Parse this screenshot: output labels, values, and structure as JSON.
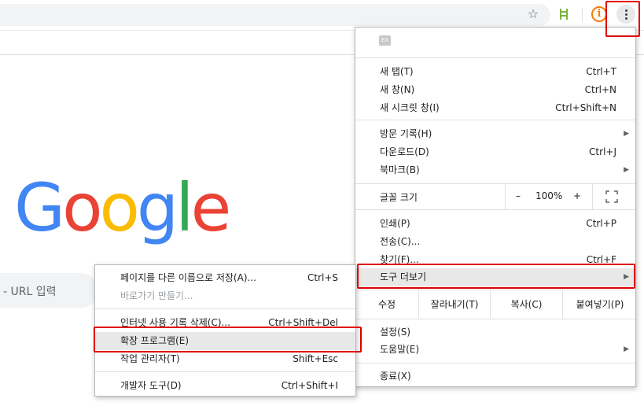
{
  "toolbar": {
    "star_icon": "star-icon",
    "extension_icons": [
      "ladder-extension-icon",
      "info-extension-icon"
    ],
    "info_glyph": "i"
  },
  "page": {
    "logo_text": "Google",
    "logo_letters": [
      {
        "char": "G",
        "color": "#4285F4"
      },
      {
        "char": "o",
        "color": "#EA4335"
      },
      {
        "char": "o",
        "color": "#FBBC05"
      },
      {
        "char": "g",
        "color": "#4285F4"
      },
      {
        "char": "l",
        "color": "#34A853"
      },
      {
        "char": "e",
        "color": "#EA4335"
      }
    ],
    "search_placeholder": "- URL 입력"
  },
  "main_menu": {
    "items": {
      "new_tab": {
        "label": "새 탭(T)",
        "shortcut": "Ctrl+T"
      },
      "new_window": {
        "label": "새 창(N)",
        "shortcut": "Ctrl+N"
      },
      "incognito": {
        "label": "새 시크릿 창(I)",
        "shortcut": "Ctrl+Shift+N"
      },
      "history": {
        "label": "방문 기록(H)"
      },
      "downloads": {
        "label": "다운로드(D)",
        "shortcut": "Ctrl+J"
      },
      "bookmarks": {
        "label": "북마크(B)"
      },
      "print": {
        "label": "인쇄(P)",
        "shortcut": "Ctrl+P"
      },
      "cast": {
        "label": "전송(C)..."
      },
      "find": {
        "label": "찾기(F)...",
        "shortcut": "Ctrl+F"
      },
      "more_tools": {
        "label": "도구 더보기"
      },
      "settings": {
        "label": "설정(S)"
      },
      "help": {
        "label": "도움말(E)"
      },
      "exit": {
        "label": "종료(X)"
      }
    },
    "zoom": {
      "label": "글꼴 크기",
      "minus": "–",
      "value": "100%",
      "plus": "+"
    },
    "edit": {
      "label": "수정",
      "cut": "잘라내기(T)",
      "copy": "복사(C)",
      "paste": "붙여넣기(P)"
    }
  },
  "sub_menu": {
    "items": {
      "save_page": {
        "label": "페이지를 다른 이름으로 저장(A)...",
        "shortcut": "Ctrl+S"
      },
      "create_shortcut": {
        "label": "바로가기 만들기..."
      },
      "clear_data": {
        "label": "인터넷 사용 기록 삭제(C)...",
        "shortcut": "Ctrl+Shift+Del"
      },
      "extensions": {
        "label": "확장 프로그램(E)"
      },
      "task_manager": {
        "label": "작업 관리자(T)",
        "shortcut": "Shift+Esc"
      },
      "dev_tools": {
        "label": "개발자 도구(D)",
        "shortcut": "Ctrl+Shift+I"
      }
    }
  },
  "colors": {
    "annotation": "#e00000",
    "hover": "#e8e8e8"
  }
}
